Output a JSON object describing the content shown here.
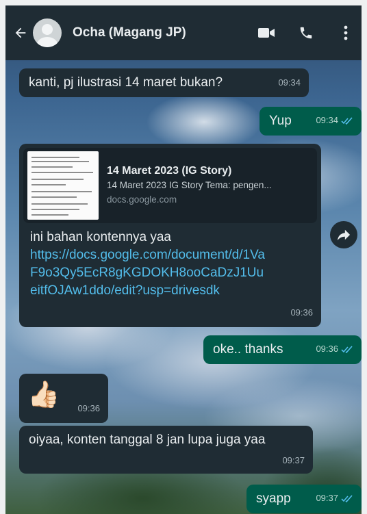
{
  "header": {
    "contact_name": "Ocha (Magang JP)",
    "icons": [
      "back-arrow-icon",
      "avatar",
      "video-call-icon",
      "phone-icon",
      "more-vertical-icon"
    ]
  },
  "messages": [
    {
      "direction": "in",
      "text": "kanti, pj ilustrasi 14 maret bukan?",
      "time": "09:34"
    },
    {
      "direction": "out",
      "text": "Yup",
      "time": "09:34",
      "status": "read"
    },
    {
      "direction": "in",
      "link_preview": {
        "title": "14 Maret 2023 (IG Story)",
        "description": "14 Maret 2023 IG Story Tema: pengen...",
        "domain": "docs.google.com"
      },
      "text": "ini bahan kontennya yaa",
      "url": "https://docs.google.com/document/d/1VaF9o3Qy5EcR8gKGDOKH8ooCaDzJ1UueitfOJAw1ddo/edit?usp=drivesdk",
      "time": "09:36"
    },
    {
      "direction": "out",
      "text": "oke.. thanks",
      "time": "09:36",
      "status": "read"
    },
    {
      "direction": "in",
      "emoji": "👍🏻",
      "time": "09:36"
    },
    {
      "direction": "in",
      "text": "oiyaa, konten tanggal 8 jan lupa juga yaa",
      "time": "09:37"
    },
    {
      "direction": "out",
      "text": "syapp",
      "time": "09:37",
      "status": "read"
    }
  ],
  "colors": {
    "header_bg": "#1f2c34",
    "incoming_bubble": "#1f2c34",
    "outgoing_bubble": "#005c4b",
    "link": "#53bdeb",
    "read_ticks": "#53bdeb"
  }
}
